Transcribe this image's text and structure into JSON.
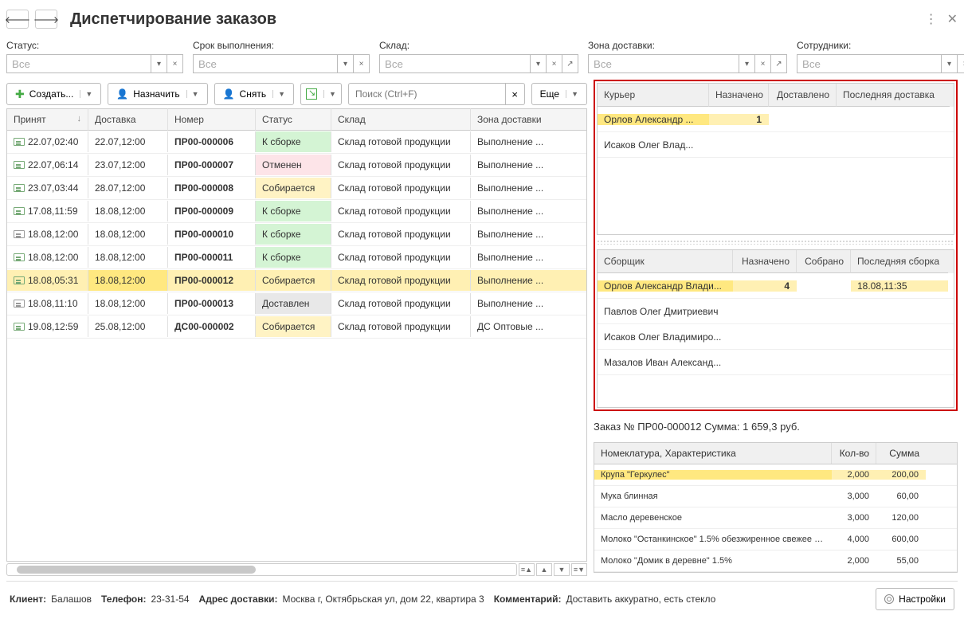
{
  "title": "Диспетчирование заказов",
  "filters": {
    "status": {
      "label": "Статус:",
      "value": "Все"
    },
    "deadline": {
      "label": "Срок выполнения:",
      "value": "Все"
    },
    "warehouse": {
      "label": "Склад:",
      "value": "Все"
    },
    "zone": {
      "label": "Зона доставки:",
      "value": "Все"
    },
    "employees": {
      "label": "Сотрудники:",
      "value": "Все"
    }
  },
  "toolbar": {
    "create": "Создать...",
    "assign": "Назначить",
    "remove": "Снять",
    "more": "Еще",
    "search_placeholder": "Поиск (Ctrl+F)"
  },
  "orders_grid": {
    "headers": {
      "accepted": "Принят",
      "delivery": "Доставка",
      "number": "Номер",
      "status": "Статус",
      "warehouse": "Склад",
      "zone": "Зона доставки"
    },
    "rows": [
      {
        "accepted": "22.07,02:40",
        "delivery": "22.07,12:00",
        "number": "ПР00-000006",
        "status": "К сборке",
        "status_cls": "status-green",
        "warehouse": "Склад готовой продукции",
        "zone": "Выполнение ...",
        "selected": false,
        "gray": false
      },
      {
        "accepted": "22.07,06:14",
        "delivery": "23.07,12:00",
        "number": "ПР00-000007",
        "status": "Отменен",
        "status_cls": "status-pink",
        "warehouse": "Склад готовой продукции",
        "zone": "Выполнение ...",
        "selected": false,
        "gray": false
      },
      {
        "accepted": "23.07,03:44",
        "delivery": "28.07,12:00",
        "number": "ПР00-000008",
        "status": "Собирается",
        "status_cls": "status-yellow",
        "warehouse": "Склад готовой продукции",
        "zone": "Выполнение ...",
        "selected": false,
        "gray": false
      },
      {
        "accepted": "17.08,11:59",
        "delivery": "18.08,12:00",
        "number": "ПР00-000009",
        "status": "К сборке",
        "status_cls": "status-green",
        "warehouse": "Склад готовой продукции",
        "zone": "Выполнение ...",
        "selected": false,
        "gray": false
      },
      {
        "accepted": "18.08,12:00",
        "delivery": "18.08,12:00",
        "number": "ПР00-000010",
        "status": "К сборке",
        "status_cls": "status-green",
        "warehouse": "Склад готовой продукции",
        "zone": "Выполнение ...",
        "selected": false,
        "gray": true
      },
      {
        "accepted": "18.08,12:00",
        "delivery": "18.08,12:00",
        "number": "ПР00-000011",
        "status": "К сборке",
        "status_cls": "status-green",
        "warehouse": "Склад готовой продукции",
        "zone": "Выполнение ...",
        "selected": false,
        "gray": false
      },
      {
        "accepted": "18.08,05:31",
        "delivery": "18.08,12:00",
        "number": "ПР00-000012",
        "status": "Собирается",
        "status_cls": "status-yellow",
        "warehouse": "Склад готовой продукции",
        "zone": "Выполнение ...",
        "selected": true,
        "gray": false
      },
      {
        "accepted": "18.08,11:10",
        "delivery": "18.08,12:00",
        "number": "ПР00-000013",
        "status": "Доставлен",
        "status_cls": "status-gray",
        "warehouse": "Склад готовой продукции",
        "zone": "Выполнение ...",
        "selected": false,
        "gray": true
      },
      {
        "accepted": "19.08,12:59",
        "delivery": "25.08,12:00",
        "number": "ДС00-000002",
        "status": "Собирается",
        "status_cls": "status-yellow",
        "warehouse": "Склад готовой продукции",
        "zone": "ДС Оптовые ...",
        "selected": false,
        "gray": false
      }
    ]
  },
  "couriers": {
    "headers": {
      "name": "Курьер",
      "assigned": "Назначено",
      "delivered": "Доставлено",
      "last": "Последняя доставка"
    },
    "rows": [
      {
        "name": "Орлов Александр ...",
        "assigned": "1",
        "delivered": "",
        "last": "",
        "sel": true
      },
      {
        "name": "Исаков Олег Влад...",
        "assigned": "",
        "delivered": "",
        "last": "",
        "sel": false
      }
    ]
  },
  "collectors": {
    "headers": {
      "name": "Сборщик",
      "assigned": "Назначено",
      "collected": "Собрано",
      "last": "Последняя сборка"
    },
    "rows": [
      {
        "name": "Орлов Александр Влади...",
        "assigned": "4",
        "collected": "",
        "last": "18.08,11:35",
        "sel": true
      },
      {
        "name": "Павлов Олег Дмитриевич",
        "assigned": "",
        "collected": "",
        "last": "",
        "sel": false
      },
      {
        "name": "Исаков Олег Владимиро...",
        "assigned": "",
        "collected": "",
        "last": "",
        "sel": false
      },
      {
        "name": "Мазалов Иван Александ...",
        "assigned": "",
        "collected": "",
        "last": "",
        "sel": false
      }
    ]
  },
  "order_summary": "Заказ № ПР00-000012   Сумма: 1 659,3 руб.",
  "items": {
    "headers": {
      "name": "Номеклатура, Характеристика",
      "qty": "Кол-во",
      "sum": "Сумма"
    },
    "rows": [
      {
        "name": "Крупа \"Геркулес\"",
        "qty": "2,000",
        "sum": "200,00",
        "sel": true
      },
      {
        "name": "Мука блинная",
        "qty": "3,000",
        "sum": "60,00",
        "sel": false
      },
      {
        "name": "Масло деревенское",
        "qty": "3,000",
        "sum": "120,00",
        "sel": false
      },
      {
        "name": "Молоко \"Останкинское\" 1.5% обезжиренное свежее о...",
        "qty": "4,000",
        "sum": "600,00",
        "sel": false
      },
      {
        "name": "Молоко \"Домик в деревне\" 1.5%",
        "qty": "2,000",
        "sum": "55,00",
        "sel": false
      }
    ]
  },
  "footer": {
    "client_label": "Клиент:",
    "client": "Балашов",
    "phone_label": "Телефон:",
    "phone": "23-31-54",
    "address_label": "Адрес доставки:",
    "address": "Москва г, Октябрьская ул, дом 22, квартира 3",
    "comment_label": "Комментарий:",
    "comment": "Доставить аккуратно, есть стекло",
    "settings": "Настройки"
  }
}
